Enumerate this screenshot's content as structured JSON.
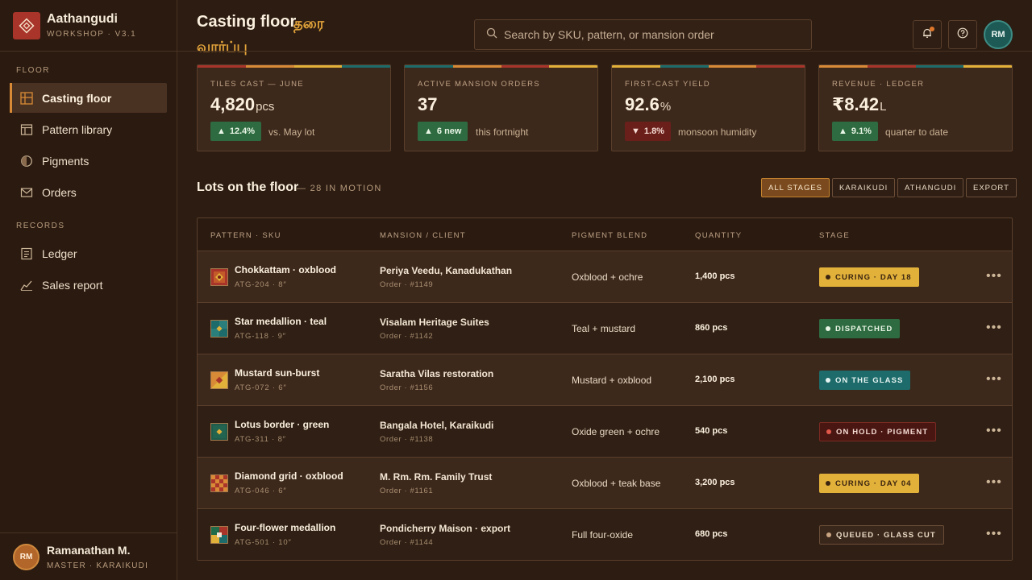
{
  "brand": {
    "name": "Aathangudi",
    "subtitle": "WORKSHOP · V3.1"
  },
  "nav": {
    "floor_section": "FLOOR",
    "records_section": "RECORDS",
    "items": [
      {
        "label": "Casting floor",
        "icon": "grid-icon",
        "active": true
      },
      {
        "label": "Pattern library",
        "icon": "layout-icon",
        "active": false
      },
      {
        "label": "Pigments",
        "icon": "pigment-icon",
        "active": false
      },
      {
        "label": "Orders",
        "icon": "mail-icon",
        "active": false
      },
      {
        "label": "Ledger",
        "icon": "document-icon",
        "active": false
      },
      {
        "label": "Sales report",
        "icon": "trend-icon",
        "active": false
      }
    ]
  },
  "user": {
    "initials": "RM",
    "name": "Ramanathan M.",
    "role": "MASTER · KARAIKUDI"
  },
  "header": {
    "title": "Casting floor",
    "title_ta_1": "தரை",
    "title_ta_2": "வார்ப்பு",
    "search_placeholder": "Search by SKU, pattern, or mansion order",
    "avatar_initials": "RM"
  },
  "kpis": [
    {
      "label": "TILES CAST — JUNE",
      "value": "4,820",
      "unit": "pcs",
      "delta": "12.4%",
      "direction": "up",
      "note": "vs. May lot"
    },
    {
      "label": "ACTIVE MANSION ORDERS",
      "value": "37",
      "unit": "",
      "delta": "6 new",
      "direction": "up",
      "note": "this fortnight"
    },
    {
      "label": "FIRST-CAST YIELD",
      "value": "92.6",
      "unit": "%",
      "delta": "1.8%",
      "direction": "down",
      "note": "monsoon humidity"
    },
    {
      "label": "REVENUE · LEDGER",
      "value": "₹8.42",
      "unit": "L",
      "delta": "9.1%",
      "direction": "up",
      "note": "quarter to date"
    }
  ],
  "lots": {
    "title": "Lots on the floor",
    "count": "— 28 IN MOTION",
    "filters": [
      "ALL STAGES",
      "KARAIKUDI",
      "ATHANGUDI",
      "EXPORT"
    ],
    "columns": [
      "PATTERN · SKU",
      "MANSION / CLIENT",
      "PIGMENT BLEND",
      "QUANTITY",
      "STAGE"
    ],
    "rows": [
      {
        "pattern": "Chokkattam · oxblood",
        "sku": "ATG-204 · 8″",
        "client": "Periya Veedu, Kanadukathan",
        "order": "Order · #1149",
        "blend": "Oxblood + ochre",
        "qty": "1,400 pcs",
        "stage": "CURING · DAY 18",
        "stage_kind": "curing"
      },
      {
        "pattern": "Star medallion · teal",
        "sku": "ATG-118 · 9″",
        "client": "Visalam Heritage Suites",
        "order": "Order · #1142",
        "blend": "Teal + mustard",
        "qty": "860 pcs",
        "stage": "DISPATCHED",
        "stage_kind": "dispatched"
      },
      {
        "pattern": "Mustard sun-burst",
        "sku": "ATG-072 · 6″",
        "client": "Saratha Vilas restoration",
        "order": "Order · #1156",
        "blend": "Mustard + oxblood",
        "qty": "2,100 pcs",
        "stage": "ON THE GLASS",
        "stage_kind": "glass"
      },
      {
        "pattern": "Lotus border · green",
        "sku": "ATG-311 · 8″",
        "client": "Bangala Hotel, Karaikudi",
        "order": "Order · #1138",
        "blend": "Oxide green + ochre",
        "qty": "540 pcs",
        "stage": "ON HOLD · PIGMENT",
        "stage_kind": "hold"
      },
      {
        "pattern": "Diamond grid · oxblood",
        "sku": "ATG-046 · 6″",
        "client": "M. Rm. Rm. Family Trust",
        "order": "Order · #1161",
        "blend": "Oxblood + teak base",
        "qty": "3,200 pcs",
        "stage": "CURING · DAY 04",
        "stage_kind": "curing"
      },
      {
        "pattern": "Four-flower medallion",
        "sku": "ATG-501 · 10″",
        "client": "Pondicherry Maison · export",
        "order": "Order · #1144",
        "blend": "Full four-oxide",
        "qty": "680 pcs",
        "stage": "QUEUED · GLASS CUT",
        "stage_kind": "queued"
      }
    ]
  },
  "colors": {
    "accent": "#d88a36",
    "oxblood": "#a8342a",
    "teal": "#1d6b6a",
    "mustard": "#e2b13a",
    "green": "#2f6b40"
  }
}
